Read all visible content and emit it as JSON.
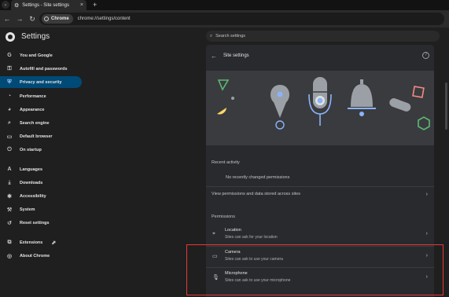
{
  "browser": {
    "tab_title": "Settings - Site settings",
    "new_tab_icon": "plus-icon",
    "url_chip": "Chrome",
    "url": "chrome://settings/content"
  },
  "header": {
    "title": "Settings",
    "search_placeholder": "Search settings"
  },
  "sidebar": {
    "items": [
      {
        "label": "You and Google",
        "icon": "google-icon"
      },
      {
        "label": "Autofill and passwords",
        "icon": "key-icon"
      },
      {
        "label": "Privacy and security",
        "icon": "shield-icon",
        "active": true
      },
      {
        "label": "Performance",
        "icon": "gauge-icon"
      },
      {
        "label": "Appearance",
        "icon": "palette-icon"
      },
      {
        "label": "Search engine",
        "icon": "search-icon"
      },
      {
        "label": "Default browser",
        "icon": "browser-icon"
      },
      {
        "label": "On startup",
        "icon": "power-icon"
      },
      {
        "label": "Languages",
        "icon": "translate-icon"
      },
      {
        "label": "Downloads",
        "icon": "download-icon"
      },
      {
        "label": "Accessibility",
        "icon": "accessibility-icon"
      },
      {
        "label": "System",
        "icon": "wrench-icon"
      },
      {
        "label": "Reset settings",
        "icon": "reset-icon"
      },
      {
        "label": "Extensions",
        "icon": "puzzle-icon"
      },
      {
        "label": "About Chrome",
        "icon": "chrome-icon"
      }
    ]
  },
  "main": {
    "title": "Site settings",
    "recent_activity_label": "Recent activity",
    "recent_activity_empty": "No recently changed permissions",
    "view_permissions_label": "View permissions and data stored across sites",
    "permissions_label": "Permissions",
    "permissions": [
      {
        "title": "Location",
        "subtitle": "Sites can ask for your location",
        "icon": "location-icon"
      },
      {
        "title": "Camera",
        "subtitle": "Sites can ask to use your camera",
        "icon": "camera-icon"
      },
      {
        "title": "Microphone",
        "subtitle": "Sites can ask to use your microphone",
        "icon": "microphone-icon"
      }
    ]
  },
  "colors": {
    "accent": "#004a77",
    "highlight_box": "#e53935"
  }
}
